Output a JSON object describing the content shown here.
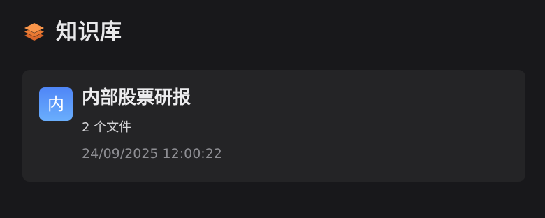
{
  "header": {
    "title": "知识库",
    "icon": "layers-icon",
    "icon_color": "#f58a3c"
  },
  "knowledge_bases": [
    {
      "badge": "内",
      "name": "内部股票研报",
      "file_count": "2 个文件",
      "updated_at": "24/09/2025 12:00:22",
      "badge_color_top": "#4f86f7",
      "badge_color_bottom": "#6aaefc"
    }
  ],
  "colors": {
    "background": "#18181b",
    "card": "#242426"
  }
}
